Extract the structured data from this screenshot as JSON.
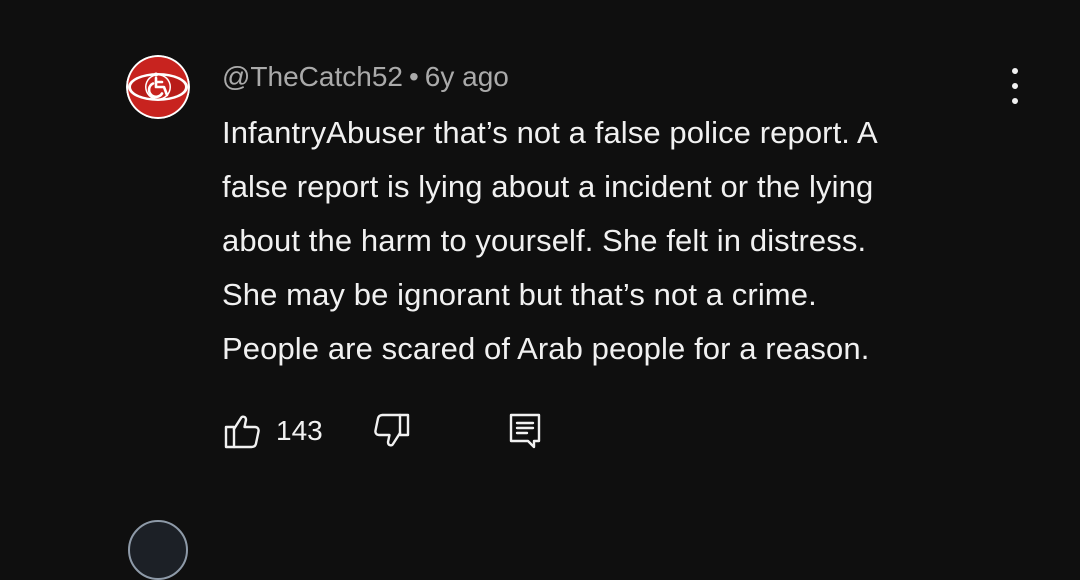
{
  "comment": {
    "author": "@TheCatch52",
    "separator": "•",
    "time": "6y ago",
    "text_lines": [
      "InfantryAbuser that’s not a false police report. A",
      "false report is lying about a incident or the lying",
      "about the harm to yourself. She felt in distress.",
      "She may be ignorant but that’s not a crime.",
      "People are scared of Arab people for a reason."
    ],
    "like_count": "143",
    "icons": {
      "avatar": "wheelchair-logo-avatar",
      "menu": "more-vert-icon",
      "like": "thumbs-up-icon",
      "dislike": "thumbs-down-icon",
      "reply": "reply-comment-icon"
    }
  },
  "colors": {
    "background": "#0f0f0f",
    "primary_text": "#f1f1f1",
    "secondary_text": "#aaaaaa",
    "avatar_red": "#c8231f"
  }
}
